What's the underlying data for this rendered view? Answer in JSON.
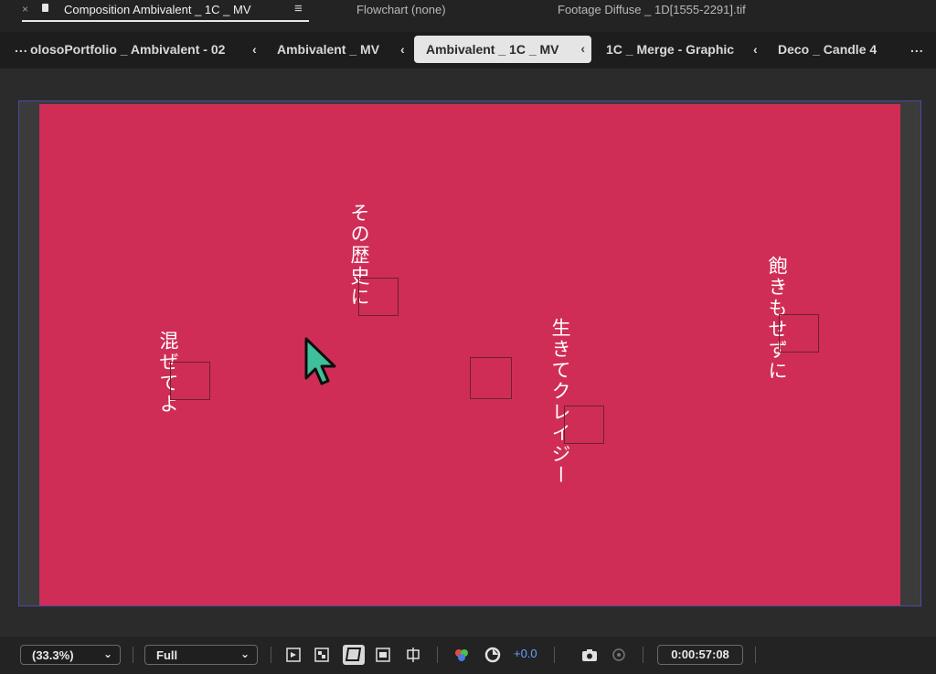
{
  "panel_tabs": {
    "close_glyph": "×",
    "composition_title": "Composition Ambivalent _ 1C _ MV",
    "menu_glyph": "≡",
    "flowchart": "Flowchart (none)",
    "footage": "Footage Diffuse _ 1D[1555-2291].tif"
  },
  "breadcrumbs": {
    "overflow_left": "...",
    "items": [
      {
        "label": "olosoPortfolio _ Ambivalent - 02"
      },
      {
        "label": "Ambivalent _ MV"
      },
      {
        "label": "Ambivalent _ 1C _ MV",
        "active": true
      },
      {
        "label": "1C _ Merge - Graphic"
      },
      {
        "label": "Deco _ Candle 4"
      }
    ],
    "chevron": "‹",
    "overflow_right": "..."
  },
  "viewer": {
    "frame_color": "#cf2d56",
    "lyrics": [
      {
        "text": "その歴史に"
      },
      {
        "text": "混ぜてよ"
      },
      {
        "text": "生きてクレイジー"
      },
      {
        "text": "飽きもせずに"
      }
    ]
  },
  "toolbar": {
    "zoom": "(33.3%)",
    "resolution": "Full",
    "exposure": "+0.0",
    "timecode": "0:00:57:08",
    "caret": "⌄"
  },
  "colors": {
    "accent_blue": "#6aa0ff",
    "comp_bounds": "#4a4aa8",
    "cursor": "#3fbf9a"
  }
}
